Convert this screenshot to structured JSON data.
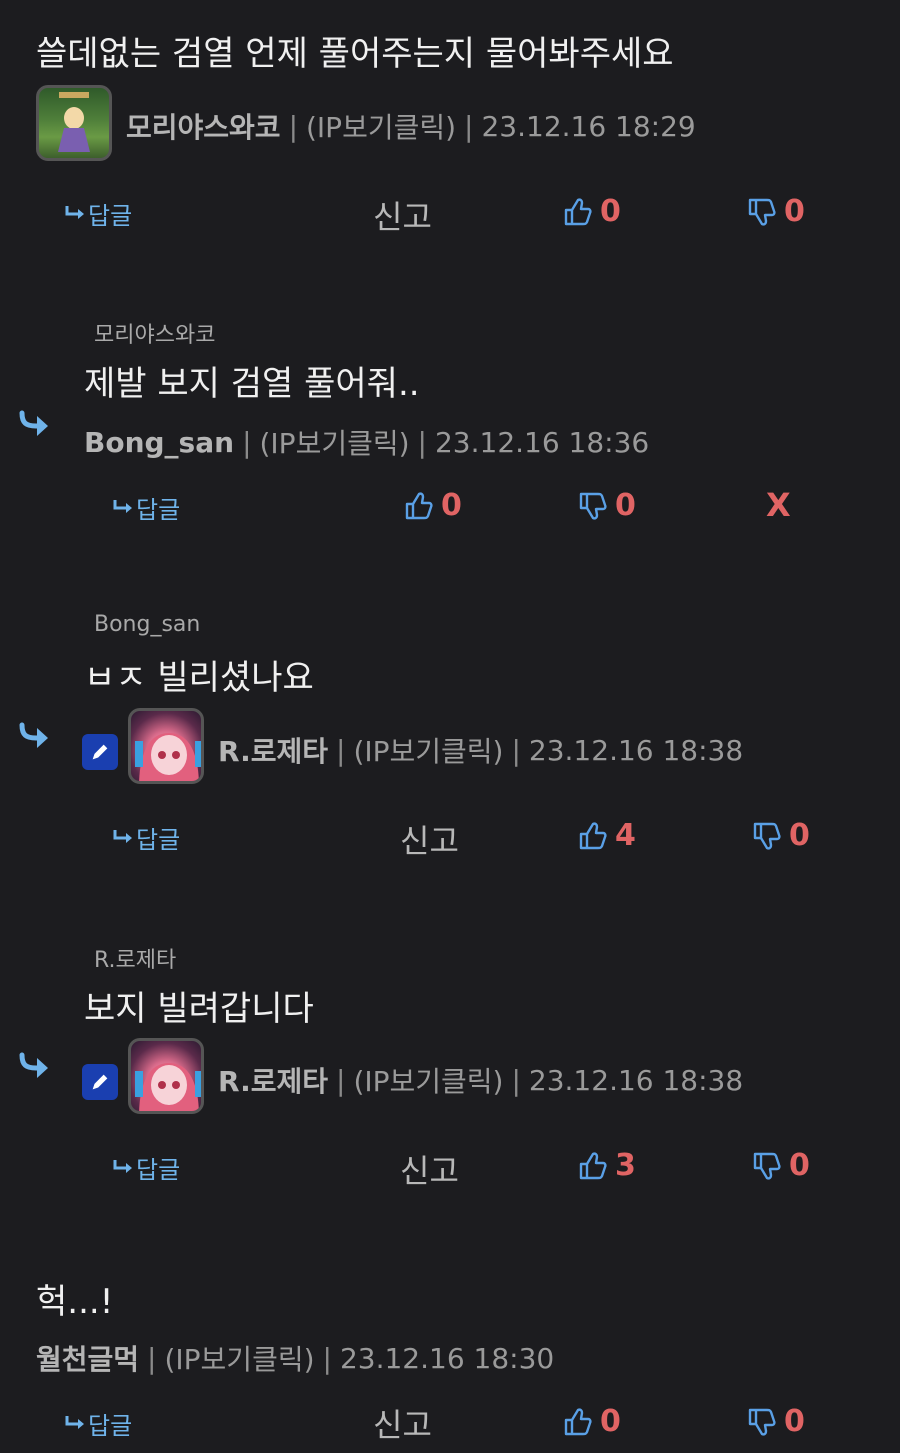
{
  "labels": {
    "reply": "답글",
    "report": "신고",
    "ip": "(IP보기클릭)",
    "delete": "X"
  },
  "comments": [
    {
      "text": "쓸데없는 검열 언제 풀어주는지 물어봐주세요",
      "author": "모리야스와코",
      "time": "23.12.16 18:29",
      "up": "0",
      "down": "0"
    },
    {
      "reply_to": "모리야스와코",
      "text": "제발 보지 검열 풀어줘..",
      "author": "Bong_san",
      "time": "23.12.16 18:36",
      "up": "0",
      "down": "0"
    },
    {
      "reply_to": "Bong_san",
      "text": "ㅂㅈ 빌리셨나요",
      "author": "R.로제타",
      "time": "23.12.16 18:38",
      "up": "4",
      "down": "0"
    },
    {
      "reply_to": "R.로제타",
      "text": "보지 빌려갑니다",
      "author": "R.로제타",
      "time": "23.12.16 18:38",
      "up": "3",
      "down": "0"
    },
    {
      "text": "헉...!",
      "author": "월천글먹",
      "time": "23.12.16 18:30",
      "up": "0",
      "down": "0"
    }
  ]
}
